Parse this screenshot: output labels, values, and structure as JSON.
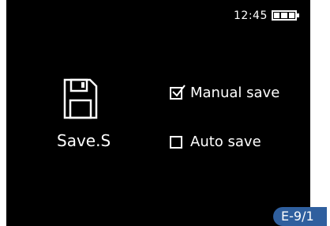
{
  "status": {
    "time": "12:45",
    "battery_icon": "battery-full-icon",
    "battery_level": 1.0
  },
  "main": {
    "icon": "floppy-disk-icon",
    "title": "Save.S"
  },
  "options": {
    "manual": {
      "label": "Manual save",
      "checked": true
    },
    "auto": {
      "label": "Auto save",
      "checked": false
    }
  },
  "page_badge": {
    "text": "E-9/1",
    "color": "#2f5f9e"
  },
  "colors": {
    "background": "#000000",
    "foreground": "#ffffff"
  }
}
